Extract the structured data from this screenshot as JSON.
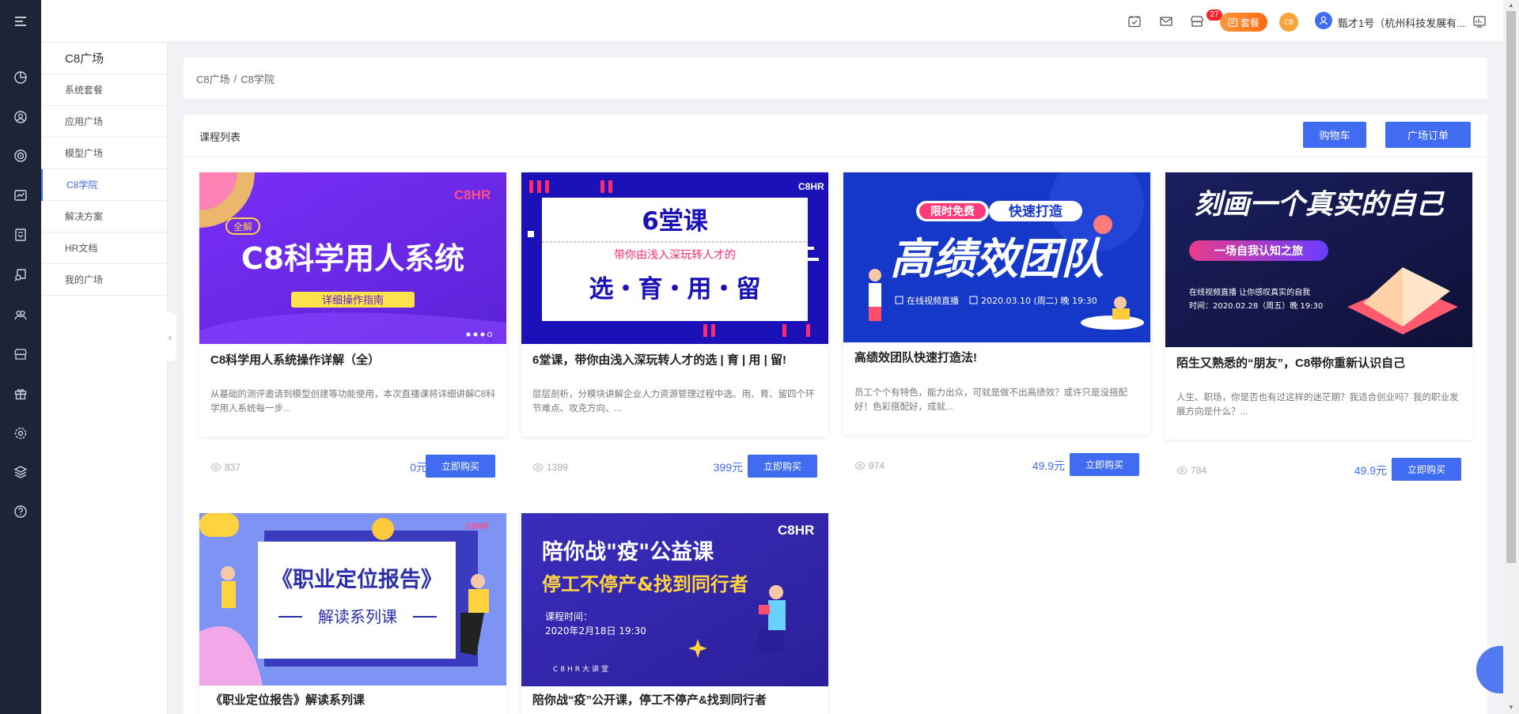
{
  "rail": {
    "icons": [
      "menu-icon",
      "pie-chart-icon",
      "user-circle-icon",
      "target-icon",
      "trend-chart-icon",
      "team-flag-icon",
      "person-search-icon",
      "group-icon",
      "store-icon",
      "gift-icon",
      "settings-icon",
      "layers-icon",
      "help-icon"
    ]
  },
  "header": {
    "mail_badge": "27",
    "package_label": "套餐",
    "c8_avatar": "C8",
    "user_name": "甄才1号（杭州科技发展有..."
  },
  "sidebar": {
    "title": "C8广场",
    "items": [
      {
        "label": "系统套餐",
        "active": false
      },
      {
        "label": "应用广场",
        "active": false
      },
      {
        "label": "模型广场",
        "active": false
      },
      {
        "label": "C8学院",
        "active": true
      },
      {
        "label": "解决方案",
        "active": false
      },
      {
        "label": "HR文档",
        "active": false
      },
      {
        "label": "我的广场",
        "active": false
      }
    ]
  },
  "breadcrumb": {
    "root": "C8广场",
    "sep": "/",
    "current": "C8学院"
  },
  "panel": {
    "title": "课程列表",
    "cart_label": "购物车",
    "orders_label": "广场订单"
  },
  "courses": [
    {
      "title": "C8科学用人系统操作详解（全）",
      "desc": "从基础的测评邀请到模型创建等功能使用，本次直播课将详细讲解C8科学用人系统每一步...",
      "views": "837",
      "price": "0元",
      "buy": "立即购买",
      "banner": {
        "brand": "C8HR",
        "tag": "全解",
        "headline": "C8科学用人系统",
        "strip": "详细操作指南"
      }
    },
    {
      "title": "6堂课，带你由浅入深玩转人才的选 | 育 | 用 | 留!",
      "desc": "层层剖析，分模块讲解企业人力资源管理过程中选、用、育、留四个环节难点、攻克方向、...",
      "views": "1389",
      "price": "399元",
      "buy": "立即购买",
      "banner": {
        "brand": "C8HR",
        "headline": "6堂课",
        "sub": "带你由浅入深玩转人才的",
        "big": "选・育・用・留"
      }
    },
    {
      "title": "高绩效团队快速打造法!",
      "desc": "员工个个有特色，能力出众，可就是做不出高绩效？或许只是没搭配好！色彩搭配好，成就...",
      "views": "974",
      "price": "49.9元",
      "buy": "立即购买",
      "banner": {
        "pill_a": "限时免费",
        "pill_b": "快速打造",
        "headline": "高绩效团队",
        "live": "在线视频直播",
        "time": "2020.03.10 (周二) 晚 19:30"
      }
    },
    {
      "title": "陌生又熟悉的“朋友”，C8带你重新认识自己",
      "desc": "人生、职场，你是否也有过这样的迷茫期？我适合创业吗？我的职业发展方向是什么？...",
      "views": "784",
      "price": "49.9元",
      "buy": "立即购买",
      "banner": {
        "headline": "刻画一个真实的自己",
        "pill": "一场自我认知之旅",
        "line1": "在线视频直播 让你感叹真实的自我",
        "line2": "时间：2020.02.28（周五）晚 19:30"
      }
    },
    {
      "title": "《职业定位报告》解读系列课",
      "banner": {
        "brand": "C8HR",
        "headline": "《职业定位报告》",
        "sub": "解读系列课"
      }
    },
    {
      "title": "陪你战“疫”公开课，停工不停产&找到同行者",
      "banner": {
        "brand": "C8HR",
        "line1": "陪你战\"疫\"公益课",
        "line2": "停工不停产&找到同行者",
        "time_label": "课程时间：",
        "time": "2020年2月18日  19:30",
        "footer": "C8HR大讲堂"
      }
    }
  ],
  "colors": {
    "accent": "#3f6cf0",
    "rail": "#1c2536",
    "price": "#3f6cf0"
  }
}
